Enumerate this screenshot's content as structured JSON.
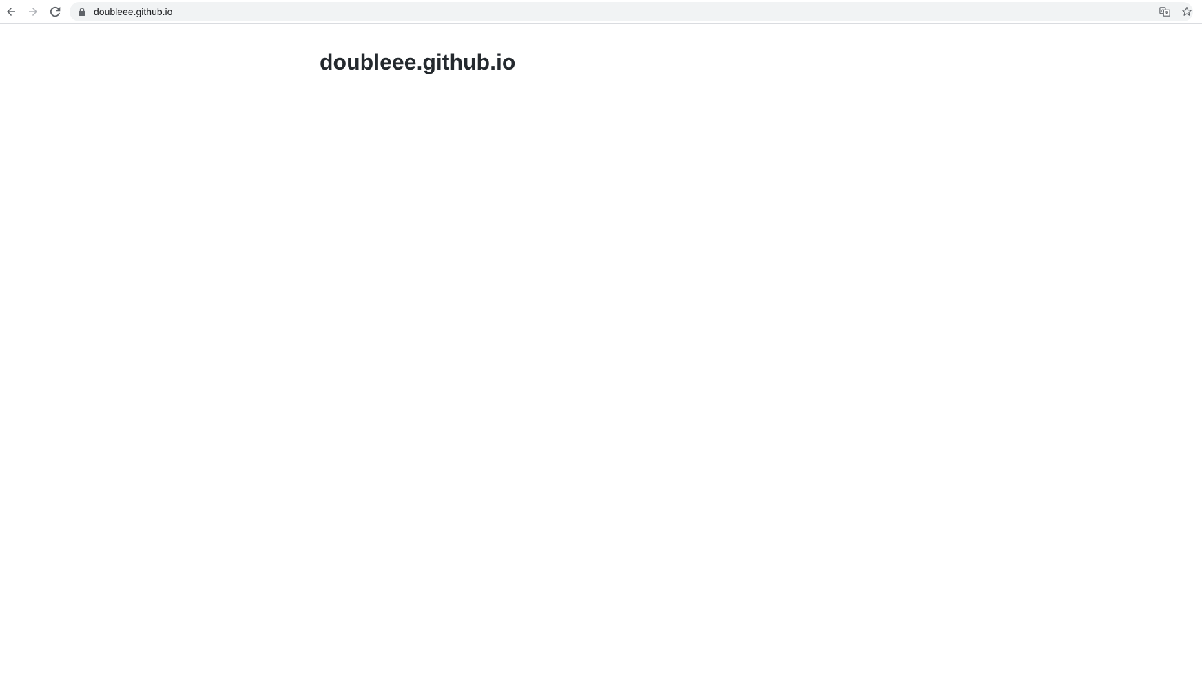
{
  "browser": {
    "url": "doubleee.github.io",
    "icons": {
      "back": "back-arrow-icon",
      "forward": "forward-arrow-icon",
      "reload": "reload-icon",
      "lock": "lock-icon",
      "translate": "translate-icon",
      "bookmark": "star-icon"
    }
  },
  "page": {
    "title": "doubleee.github.io"
  },
  "colors": {
    "title_text": "#24292e",
    "omnibox_bg": "#f1f3f4",
    "divider": "#eaecef"
  }
}
